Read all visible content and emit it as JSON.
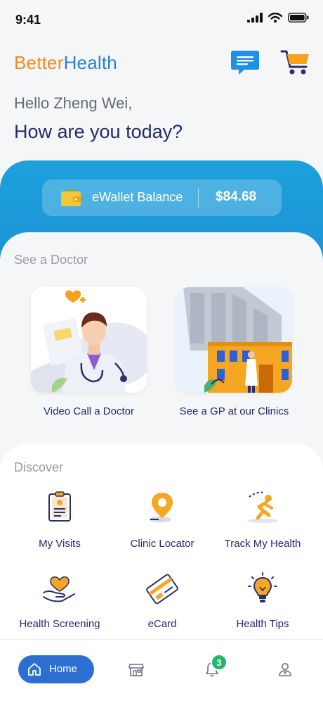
{
  "status_bar": {
    "time": "9:41"
  },
  "header": {
    "logo_better": "Better",
    "logo_health": "Health",
    "icons": [
      "chat-icon",
      "cart-icon"
    ]
  },
  "greeting": {
    "hello": "Hello Zheng Wei,",
    "question": "How are you today?"
  },
  "wallet": {
    "label": "eWallet Balance",
    "amount": "$84.68",
    "icon": "wallet-icon"
  },
  "doctor_section": {
    "title": "See a Doctor",
    "options": [
      {
        "label": "Video Call a Doctor",
        "icon": "doctor-illustration"
      },
      {
        "label": "See a GP at our Clinics",
        "icon": "clinic-illustration"
      }
    ]
  },
  "discover": {
    "title": "Discover",
    "items": [
      {
        "label": "My Visits",
        "icon": "clipboard-icon"
      },
      {
        "label": "Clinic Locator",
        "icon": "location-pin-icon"
      },
      {
        "label": "Track My Health",
        "icon": "runner-icon"
      },
      {
        "label": "Health Screening",
        "icon": "heart-hand-icon"
      },
      {
        "label": "eCard",
        "icon": "card-icon"
      },
      {
        "label": "Health Tips",
        "icon": "lightbulb-icon"
      }
    ]
  },
  "bottom_nav": {
    "home_label": "Home",
    "notification_count": "3",
    "items": [
      "home-icon",
      "store-icon",
      "bell-icon",
      "profile-icon"
    ]
  },
  "colors": {
    "brand_orange": "#f08a24",
    "brand_blue": "#2d7fd3",
    "band_blue": "#1da1dc",
    "nav_active": "#2c6fd0",
    "badge_green": "#1fb96a",
    "text_dark": "#262a6a"
  }
}
